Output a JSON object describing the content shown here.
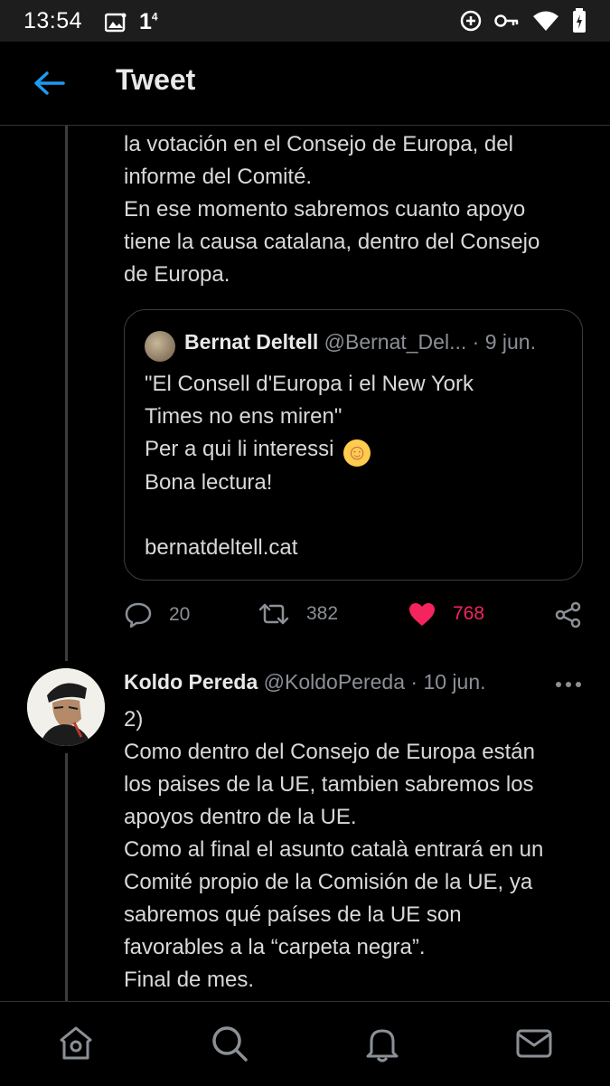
{
  "status_bar": {
    "time": "13:54",
    "notification_count": "1",
    "notification_sup": "4",
    "icons": [
      "image-icon",
      "add-circle-icon",
      "key-icon",
      "wifi-icon",
      "battery-charging-icon"
    ]
  },
  "header": {
    "title": "Tweet"
  },
  "tweet1": {
    "text_lines": [
      "la votación en el Consejo de Europa, del",
      "informe del Comité.",
      "En ese momento sabremos cuanto apoyo",
      "tiene la causa catalana, dentro del Consejo",
      "de Europa."
    ],
    "quote": {
      "name": "Bernat Deltell",
      "handle": "@Bernat_Del...",
      "date": "· 9 jun.",
      "lines": [
        "\"El Consell d'Europa i el New York",
        "Times no ens miren\"",
        "Per a qui li interessi",
        "Bona lectura!",
        "",
        "bernatdeltell.cat"
      ],
      "emoji": "☺"
    },
    "actions": {
      "replies": "20",
      "retweets": "382",
      "likes": "768"
    }
  },
  "tweet2": {
    "name": "Koldo Pereda",
    "handle": "@KoldoPereda",
    "date": "· 10 jun.",
    "text_lines": [
      "2)",
      "Como dentro del Consejo de Europa están",
      "los paises de la UE, tambien sabremos los",
      "apoyos dentro de la UE.",
      "Como al final el asunto català entrará en un",
      "Comité propio de la Comisión de la UE, ya",
      "sabremos qué países de la UE son",
      "favorables a la “carpeta negra”.",
      "Final de mes."
    ]
  },
  "colors": {
    "background": "#000000",
    "accent_blue": "#1d9bf0",
    "like_pink": "#f4245e",
    "muted": "#8b9096",
    "border": "#2f3336"
  },
  "bottom_nav": [
    "home-icon",
    "search-icon",
    "notifications-icon",
    "messages-icon"
  ]
}
